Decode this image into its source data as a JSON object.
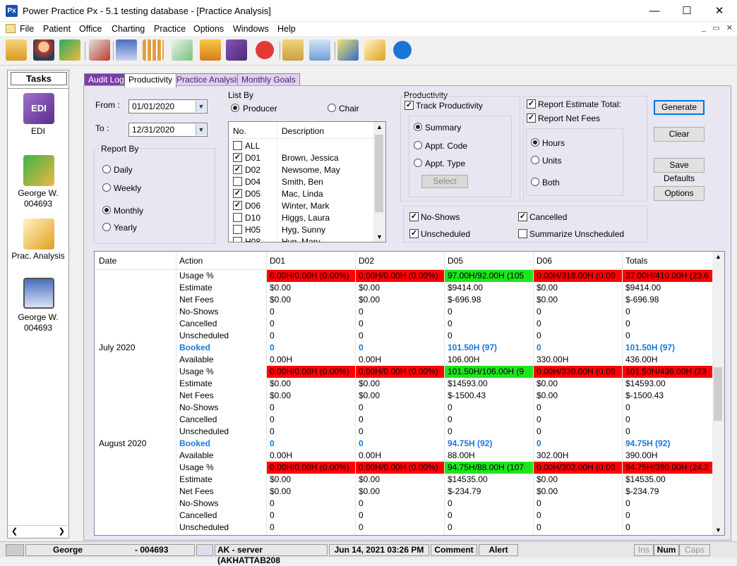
{
  "window": {
    "title": "Power Practice Px - 5.1 testing database - [Practice Analysis]",
    "app_icon": "Px"
  },
  "menu": [
    "File",
    "Patient",
    "Office",
    "Charting",
    "Practice",
    "Options",
    "Windows",
    "Help"
  ],
  "sidebar": {
    "header": "Tasks",
    "items": [
      {
        "icon": "edi-icon",
        "label": "EDI"
      },
      {
        "icon": "money-arrows-icon",
        "label": "George W.\n004693"
      },
      {
        "icon": "notepad-pencil-icon",
        "label": "Prac. Analysis"
      },
      {
        "icon": "ledger-book-icon",
        "label": "George W.\n004693"
      }
    ]
  },
  "tabs": [
    {
      "label": "Audit Log",
      "active": false
    },
    {
      "label": "Productivity",
      "active": true
    },
    {
      "label": "Practice Analysis",
      "active": false
    },
    {
      "label": "Monthly Goals",
      "active": false
    }
  ],
  "filters": {
    "from_label": "From :",
    "from_value": "01/01/2020",
    "to_label": "To :",
    "to_value": "12/31/2020",
    "report_by_label": "Report By",
    "report_by": [
      "Daily",
      "Weekly",
      "Monthly",
      "Yearly"
    ],
    "report_by_selected": "Monthly",
    "list_by_label": "List By",
    "list_by_producer": "Producer",
    "list_by_chair": "Chair",
    "list_by_selected": "Producer",
    "list_columns": {
      "no": "No.",
      "description": "Description"
    },
    "list_items": [
      {
        "no": "ALL",
        "desc": "",
        "checked": false
      },
      {
        "no": "D01",
        "desc": "Brown, Jessica",
        "checked": true
      },
      {
        "no": "D02",
        "desc": "Newsome, May",
        "checked": true
      },
      {
        "no": "D04",
        "desc": "Smith, Ben",
        "checked": false
      },
      {
        "no": "D05",
        "desc": "Mac, Linda",
        "checked": true
      },
      {
        "no": "D06",
        "desc": "Winter, Mark",
        "checked": true
      },
      {
        "no": "D10",
        "desc": "Higgs, Laura",
        "checked": false
      },
      {
        "no": "H05",
        "desc": "Hyg, Sunny",
        "checked": false
      },
      {
        "no": "H08",
        "desc": "Hyg, Mary",
        "checked": false
      }
    ],
    "productivity_label": "Productivity",
    "track_productivity": "Track Productivity",
    "summary": "Summary",
    "appt_code": "Appt. Code",
    "appt_type": "Appt. Type",
    "select_btn": "Select",
    "report_estimate": "Report Estimate Total:",
    "report_net": "Report Net Fees",
    "hours": "Hours",
    "units": "Units",
    "both": "Both",
    "no_shows": "No-Shows",
    "unscheduled": "Unscheduled",
    "cancelled": "Cancelled",
    "summarize_unscheduled": "Summarize Unscheduled"
  },
  "buttons": {
    "generate": "Generate",
    "clear": "Clear",
    "save_defaults": "Save Defaults",
    "options": "Options"
  },
  "grid": {
    "columns": [
      "Date",
      "Action",
      "D01",
      "D02",
      "D05",
      "D06",
      "Totals"
    ],
    "rows": [
      {
        "date": "",
        "action": "Usage %",
        "cells": [
          "0.00H/0.00H  (0.00%)",
          "0.00H/0.00H  (0.00%)",
          "97.00H/92.00H  (105",
          "0.00H/318.00H  (0.00",
          "37.00H/410.00H  (23.6"
        ],
        "kind": "usage",
        "colors": [
          "red",
          "red",
          "grn",
          "red",
          "red"
        ]
      },
      {
        "date": "",
        "action": "Estimate",
        "cells": [
          "$0.00",
          "$0.00",
          "$9414.00",
          "$0.00",
          "$9414.00"
        ]
      },
      {
        "date": "",
        "action": "Net Fees",
        "cells": [
          "$0.00",
          "$0.00",
          "$-696.98",
          "$0.00",
          "$-696.98"
        ]
      },
      {
        "date": "",
        "action": "No-Shows",
        "cells": [
          "0",
          "0",
          "0",
          "0",
          "0"
        ]
      },
      {
        "date": "",
        "action": "Cancelled",
        "cells": [
          "0",
          "0",
          "0",
          "0",
          "0"
        ]
      },
      {
        "date": "",
        "action": "Unscheduled",
        "cells": [
          "0",
          "0",
          "0",
          "0",
          "0"
        ]
      },
      {
        "date": "July 2020",
        "action": "Booked",
        "cells": [
          "0",
          "0",
          "101.50H   (97)",
          "0",
          "101.50H   (97)"
        ],
        "kind": "booked"
      },
      {
        "date": "",
        "action": "Available",
        "cells": [
          "0.00H",
          "0.00H",
          "106.00H",
          "330.00H",
          "436.00H"
        ]
      },
      {
        "date": "",
        "action": "Usage %",
        "cells": [
          "0.00H/0.00H  (0.00%)",
          "0.00H/0.00H  (0.00%)",
          "101.50H/106.00H  (9",
          "0.00H/330.00H  (0.00",
          "101.50H/436.00H  (23"
        ],
        "kind": "usage",
        "colors": [
          "red",
          "red",
          "grn",
          "red",
          "red"
        ]
      },
      {
        "date": "",
        "action": "Estimate",
        "cells": [
          "$0.00",
          "$0.00",
          "$14593.00",
          "$0.00",
          "$14593.00"
        ]
      },
      {
        "date": "",
        "action": "Net Fees",
        "cells": [
          "$0.00",
          "$0.00",
          "$-1500.43",
          "$0.00",
          "$-1500.43"
        ]
      },
      {
        "date": "",
        "action": "No-Shows",
        "cells": [
          "0",
          "0",
          "0",
          "0",
          "0"
        ]
      },
      {
        "date": "",
        "action": "Cancelled",
        "cells": [
          "0",
          "0",
          "0",
          "0",
          "0"
        ]
      },
      {
        "date": "",
        "action": "Unscheduled",
        "cells": [
          "0",
          "0",
          "0",
          "0",
          "0"
        ]
      },
      {
        "date": "August 2020",
        "action": "Booked",
        "cells": [
          "0",
          "0",
          "94.75H   (92)",
          "0",
          "94.75H   (92)"
        ],
        "kind": "booked"
      },
      {
        "date": "",
        "action": "Available",
        "cells": [
          "0.00H",
          "0.00H",
          "88.00H",
          "302.00H",
          "390.00H"
        ]
      },
      {
        "date": "",
        "action": "Usage %",
        "cells": [
          "0.00H/0.00H  (0.00%)",
          "0.00H/0.00H  (0.00%)",
          "94.75H/88.00H  (107",
          "0.00H/302.00H  (0.00",
          "94.75H/390.00H  (24.2"
        ],
        "kind": "usage",
        "colors": [
          "red",
          "red",
          "grn",
          "red",
          "red"
        ]
      },
      {
        "date": "",
        "action": "Estimate",
        "cells": [
          "$0.00",
          "$0.00",
          "$14535.00",
          "$0.00",
          "$14535.00"
        ]
      },
      {
        "date": "",
        "action": "Net Fees",
        "cells": [
          "$0.00",
          "$0.00",
          "$-234.79",
          "$0.00",
          "$-234.79"
        ]
      },
      {
        "date": "",
        "action": "No-Shows",
        "cells": [
          "0",
          "0",
          "0",
          "0",
          "0"
        ]
      },
      {
        "date": "",
        "action": "Cancelled",
        "cells": [
          "0",
          "0",
          "0",
          "0",
          "0"
        ]
      },
      {
        "date": "",
        "action": "Unscheduled",
        "cells": [
          "0",
          "0",
          "0",
          "0",
          "0"
        ]
      }
    ]
  },
  "status": {
    "patient": "George",
    "chart": "- 004693",
    "server": "AK - server (AKHATTAB208",
    "datetime": "Jun 14, 2021  03:26 PM",
    "comment": "Comment",
    "alert": "Alert",
    "ins": "Ins",
    "num": "Num",
    "caps": "Caps"
  }
}
